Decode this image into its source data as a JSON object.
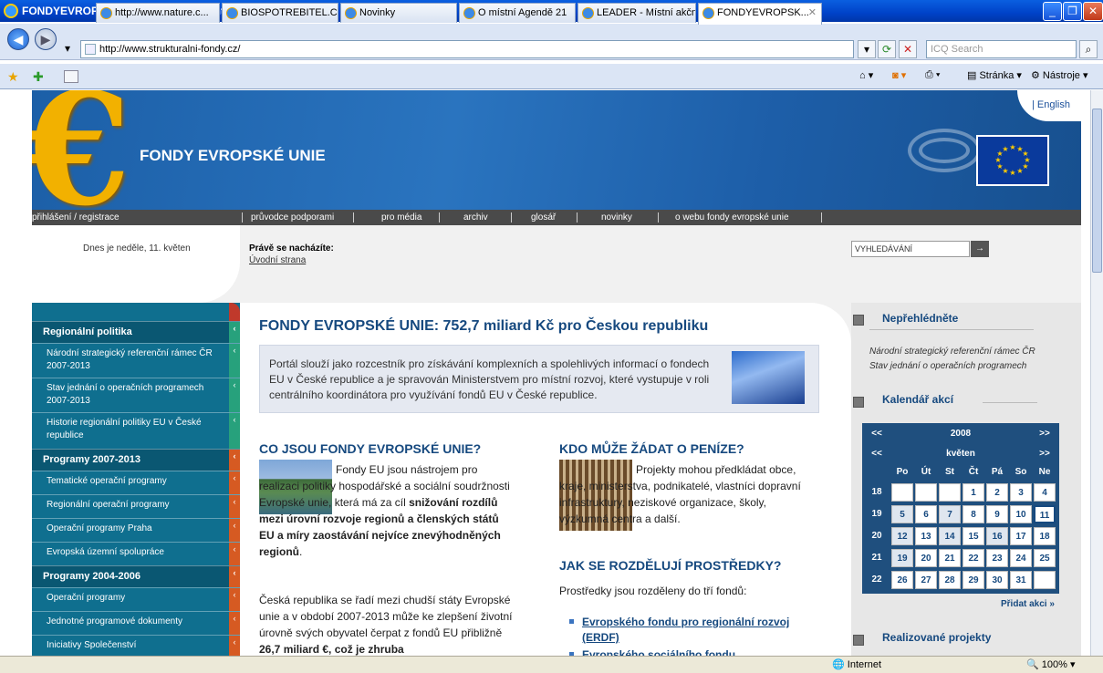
{
  "window": {
    "title": "FONDYEVROPSKÉ UNIE - Windows Internet Explorer"
  },
  "address": {
    "url": "http://www.strukturalni-fondy.cz/",
    "search_placeholder": "ICQ Search"
  },
  "tabs": [
    {
      "label": "http://www.nature.c..."
    },
    {
      "label": "BIOSPOTREBITEL.CZ"
    },
    {
      "label": "Novinky"
    },
    {
      "label": "O místní Agendě 21"
    },
    {
      "label": "LEADER - Místní akčn..."
    },
    {
      "label": "FONDYEVROPSK..."
    }
  ],
  "commands": {
    "page": "Stránka",
    "tools": "Nástroje"
  },
  "site": {
    "title": "FONDY EVROPSKÉ UNIE",
    "english": "| English",
    "topnav": [
      "přihlášení / registrace",
      "průvodce podporami",
      "pro média",
      "archiv",
      "glosář",
      "novinky",
      "o webu fondy evropské unie"
    ],
    "date": "Dnes je neděle, 11. květen",
    "youarehere_label": "Právě se nacházíte:",
    "youarehere_link": "Úvodní strana",
    "search_label": "VYHLEDÁVÁNÍ",
    "search_go": "→"
  },
  "sidebar": {
    "items": [
      {
        "label": "Regionální politika",
        "head": true
      },
      {
        "label": "Národní strategický referenční rámec ČR 2007-2013"
      },
      {
        "label": "Stav jednání o operačních programech 2007-2013"
      },
      {
        "label": "Historie regionální politiky EU v České republice"
      },
      {
        "label": "Programy 2007-2013",
        "head": true
      },
      {
        "label": "Tematické operační programy"
      },
      {
        "label": "Regionální operační programy"
      },
      {
        "label": "Operační programy Praha"
      },
      {
        "label": "Evropská územní spolupráce"
      },
      {
        "label": "Programy 2004-2006",
        "head": true
      },
      {
        "label": "Operační programy"
      },
      {
        "label": "Jednotné programové dokumenty"
      },
      {
        "label": "Iniciativy Společenství"
      }
    ]
  },
  "main": {
    "title": "FONDY EVROPSKÉ UNIE: 752,7 miliard Kč pro Českou republiku",
    "intro": "Portál slouží jako rozcestník pro získávání komplexních a spolehlivých informací o fondech EU v České republice a je spravován Ministerstvem pro místní rozvoj, které vystupuje v roli centrálního koordinátora pro využívání fondů EU v České republice.",
    "what_title": "CO JSOU FONDY EVROPSKÉ UNIE?",
    "what_p1_a": "Fondy EU jsou nástrojem pro realizaci politiky hospodářské a sociální soudržnosti Evropské unie, která má za cíl ",
    "what_p1_b": "snižování rozdílů mezi úrovní rozvoje regionů a členských států EU a míry zaostávání nejvíce znevýhodněných regionů",
    "what_p1_c": ".",
    "what_p2_a": "Česká republika se řadí mezi chudší státy Evropské unie a v období 2007-2013 může ke zlepšení životní úrovně svých obyvatel čerpat z fondů EU přibližně ",
    "what_p2_b": "26,7 miliard €, což je zhruba",
    "who_title": "KDO MŮŽE ŽÁDAT O PENÍZE?",
    "who_p": "Projekty mohou předkládat obce, kraje, ministerstva, podnikatelé, vlastníci dopravní infrastruktury, neziskové organizace, školy, výzkumná centra a další.",
    "how_title": "JAK SE ROZDĚLUJÍ PROSTŘEDKY?",
    "how_p": "Prostředky jsou rozděleny do tří fondů:",
    "fund1": "Evropského fondu pro regionální rozvoj (ERDF)",
    "fund2": "Evropského sociálního fondu"
  },
  "right": {
    "dontmiss_title": "Nepřehlédněte",
    "dontmiss_links": [
      "Národní strategický referenční rámec ČR",
      "Stav jednání o operačních programech"
    ],
    "calendar_title": "Kalendář akcí",
    "year": "2008",
    "month": "květen",
    "prev": "<<",
    "next": ">>",
    "weekdays": [
      "Po",
      "Út",
      "St",
      "Čt",
      "Pá",
      "So",
      "Ne"
    ],
    "weeks": [
      {
        "wk": "18",
        "days": [
          "",
          "",
          "",
          "1",
          "2",
          "3",
          "4"
        ]
      },
      {
        "wk": "19",
        "days": [
          "5",
          "6",
          "7",
          "8",
          "9",
          "10",
          "11"
        ]
      },
      {
        "wk": "20",
        "days": [
          "12",
          "13",
          "14",
          "15",
          "16",
          "17",
          "18"
        ]
      },
      {
        "wk": "21",
        "days": [
          "19",
          "20",
          "21",
          "22",
          "23",
          "24",
          "25"
        ]
      },
      {
        "wk": "22",
        "days": [
          "26",
          "27",
          "28",
          "29",
          "30",
          "31",
          ""
        ]
      }
    ],
    "add_action": "Přidat akci »",
    "projects_title": "Realizované projekty"
  },
  "status": {
    "zone": "Internet",
    "zoom": "100%"
  }
}
